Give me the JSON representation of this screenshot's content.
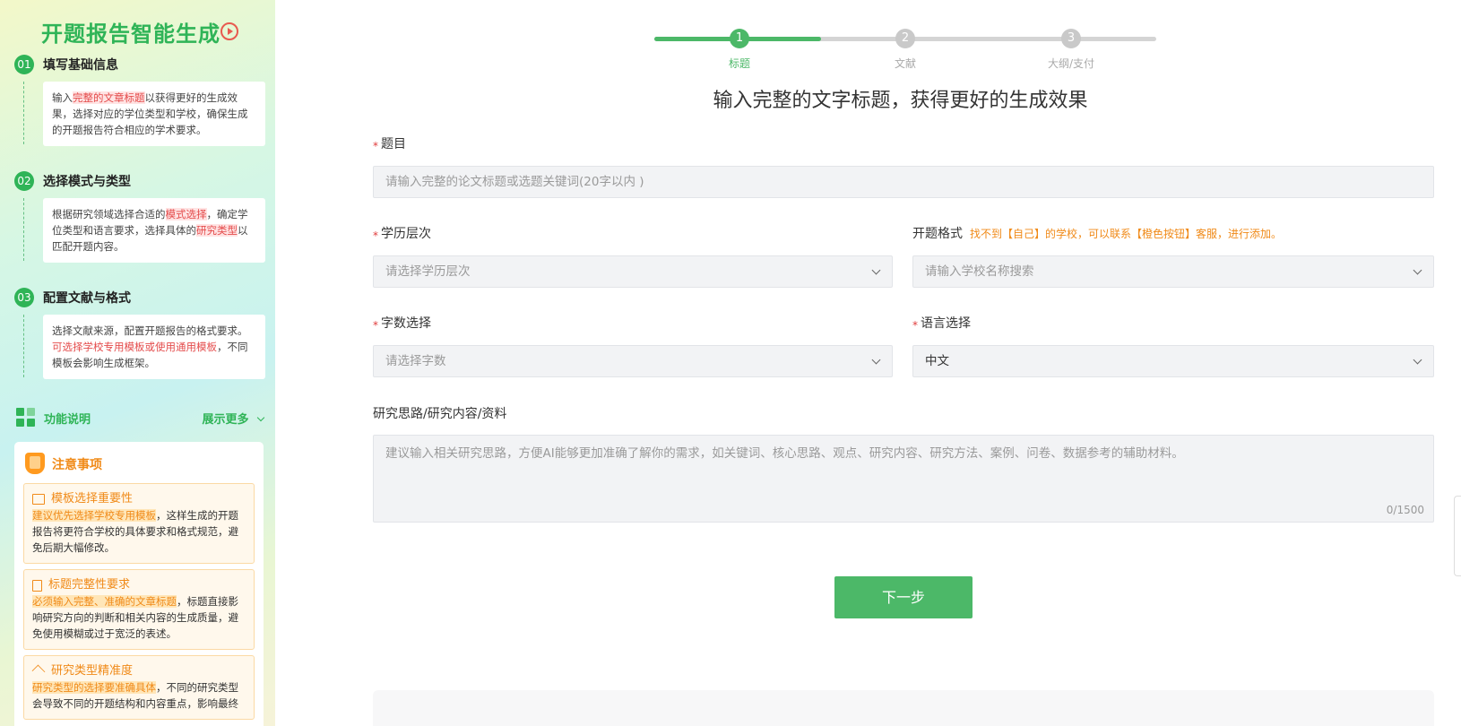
{
  "sidebar": {
    "title": "开题报告智能生成",
    "steps": [
      {
        "num": "01",
        "title": "填写基础信息",
        "card": {
          "pre": "输入",
          "hl1": "完整的文章标题",
          "mid": "以获得更好的生成效果，选择对应的学位类型和学校，确保生成的开题报告符合相应的学术要求。"
        }
      },
      {
        "num": "02",
        "title": "选择模式与类型",
        "card": {
          "pre": "根据研究领域选择合适的",
          "hl1": "模式选择",
          "mid": "，确定学位类型和语言要求，选择具体的",
          "hl2": "研究类型",
          "post": "以匹配开题内容。"
        }
      },
      {
        "num": "03",
        "title": "配置文献与格式",
        "card": {
          "pre": "选择文献来源，配置开题报告的格式要求。",
          "red": "可选择学校专用模板或使用通用模板",
          "post": "，不同模板会影响生成框架。"
        }
      }
    ],
    "function_label": "功能说明",
    "show_more": "展示更多",
    "notice": {
      "title": "注意事项",
      "cards": [
        {
          "title": "模板选择重要性",
          "hl": "建议优先选择学校专用模板",
          "text": "，这样生成的开题报告将更符合学校的具体要求和格式规范，避免后期大幅修改。"
        },
        {
          "title": "标题完整性要求",
          "hl": "必须输入完整、准确的文章标题",
          "text": "，标题直接影响研究方向的判断和相关内容的生成质量，避免使用模糊或过于宽泛的表述。"
        },
        {
          "title": "研究类型精准度",
          "hl": "研究类型的选择要准确具体",
          "text": "，不同的研究类型会导致不同的开题结构和内容重点，影响最终"
        }
      ]
    }
  },
  "stepper": {
    "steps": [
      {
        "num": "1",
        "label": "标题",
        "active": true
      },
      {
        "num": "2",
        "label": "文献",
        "active": false
      },
      {
        "num": "3",
        "label": "大纲/支付",
        "active": false
      }
    ],
    "progress": 0.333
  },
  "form": {
    "heading": "输入完整的文字标题，获得更好的生成效果",
    "required_mark": "*",
    "topic": {
      "label": "题目",
      "placeholder": "请输入完整的论文标题或选题关键词(20字以内 )"
    },
    "degree": {
      "label": "学历层次",
      "placeholder": "请选择学历层次"
    },
    "format": {
      "label": "开题格式",
      "note": "找不到【自己】的学校，可以联系【橙色按钮】客服，进行添加。",
      "placeholder": "请输入学校名称搜索"
    },
    "word_count": {
      "label": "字数选择",
      "placeholder": "请选择字数"
    },
    "language": {
      "label": "语言选择",
      "value": "中文"
    },
    "research": {
      "label": "研究思路/研究内容/资料",
      "placeholder": "建议输入相关研究思路，方便AI能够更加准确了解你的需求，如关键词、核心思路、观点、研究内容、研究方法、案例、问卷、数据参考的辅助材料。",
      "counter": "0/1500"
    },
    "next_button": "下一步"
  },
  "colors": {
    "accent": "#4cb868",
    "brand_green": "#2fb457",
    "orange": "#f08a18",
    "required": "#e03c3c"
  }
}
